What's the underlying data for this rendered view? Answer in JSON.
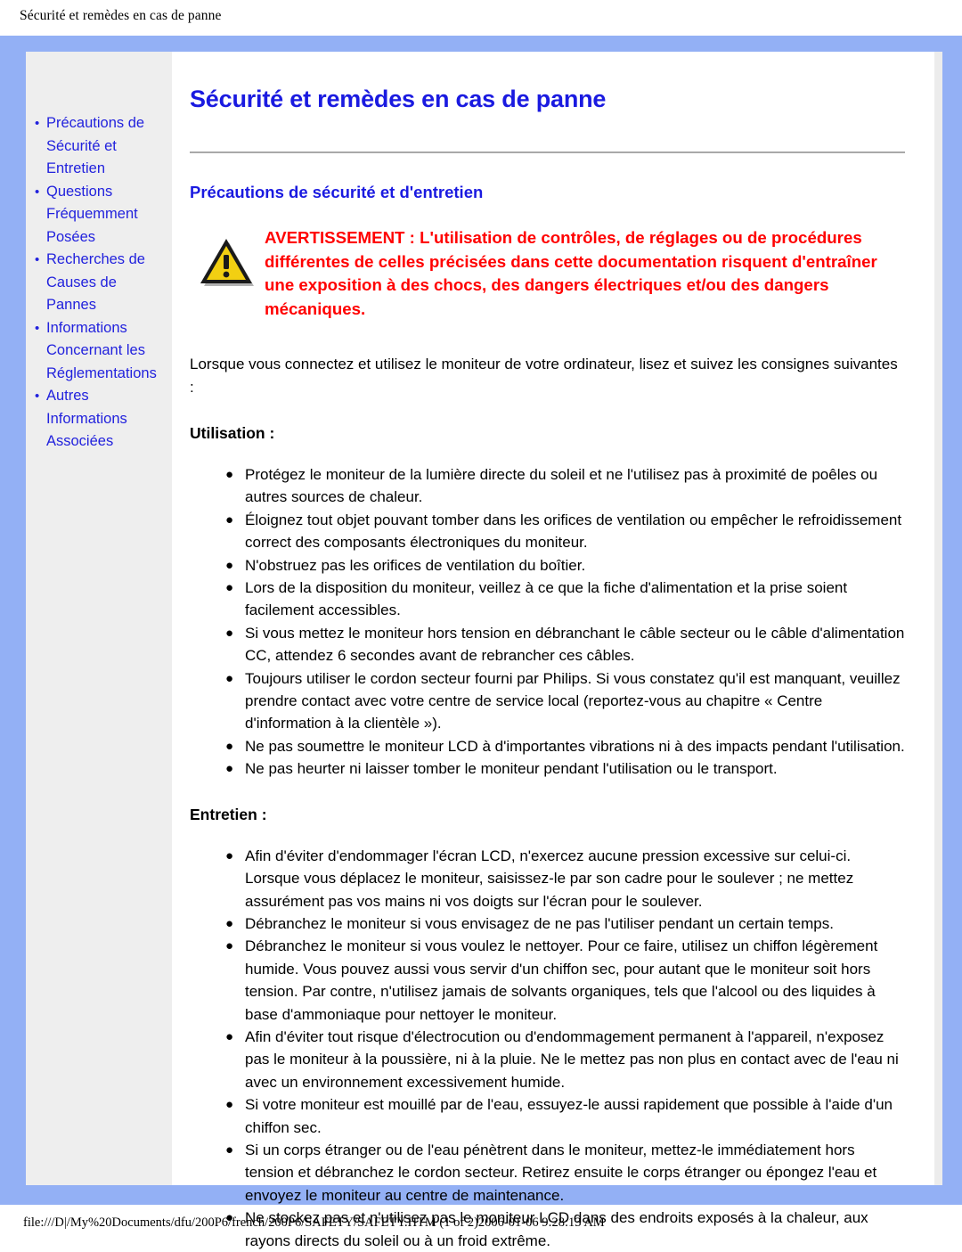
{
  "browser": {
    "header_title": "Sécurité et remèdes en cas de panne",
    "footer_text": "file:///D|/My%20Documents/dfu/200P6/french/200P6/SAFETY/SAFETY.HTM (1 of 2)2006-01-06 9:28:13 AM"
  },
  "colors": {
    "frame_blue": "#93b0f5",
    "sidebar_gray": "#eeeeee",
    "link_blue": "#2222dd",
    "heading_blue": "#1a1ae0",
    "warning_red": "#ff0000",
    "rule_gray": "#a9a9a9"
  },
  "sidebar": {
    "bullet": "•",
    "items": [
      {
        "label": "Précautions de Sécurité et Entretien"
      },
      {
        "label": "Questions Fréquemment Posées"
      },
      {
        "label": "Recherches de Causes de Pannes"
      },
      {
        "label": "Informations Concernant les Réglementations"
      },
      {
        "label": "Autres Informations Associées"
      }
    ]
  },
  "main": {
    "title": "Sécurité et remèdes en cas de panne",
    "section_title": "Précautions de sécurité et d'entretien",
    "warning": {
      "icon": "warning-triangle-icon",
      "text": "AVERTISSEMENT : L'utilisation de contrôles, de réglages ou de procédures différentes de celles précisées dans cette documentation risquent d'entraîner une exposition à des chocs, des dangers électriques et/ou des dangers mécaniques."
    },
    "intro": "Lorsque vous connectez et utilisez le moniteur de votre ordinateur, lisez et suivez les consignes suivantes :",
    "list_bullet": "●",
    "usage": {
      "heading": "Utilisation :",
      "items": [
        "Protégez le moniteur de la lumière directe du soleil et ne l'utilisez pas à proximité de poêles ou autres sources de chaleur.",
        "Éloignez tout objet pouvant tomber dans les orifices de ventilation ou empêcher le refroidissement correct des composants électroniques du moniteur.",
        "N'obstruez pas les orifices de ventilation du boîtier.",
        "Lors de la disposition du moniteur, veillez à ce que la fiche d'alimentation et la prise soient facilement accessibles.",
        "Si vous mettez le moniteur hors tension en débranchant le câble secteur ou le câble d'alimentation CC, attendez 6 secondes avant de rebrancher ces câbles.",
        "Toujours utiliser le cordon secteur fourni par Philips. Si vous constatez qu'il est manquant, veuillez prendre contact avec votre centre de service local (reportez-vous au chapitre « Centre d'information à la clientèle »).",
        "Ne pas soumettre le moniteur LCD à d'importantes vibrations ni à des impacts pendant l'utilisation.",
        "Ne pas heurter ni laisser tomber le moniteur pendant l'utilisation ou le transport."
      ]
    },
    "maintenance": {
      "heading": "Entretien :",
      "items": [
        "Afin d'éviter d'endommager l'écran LCD, n'exercez aucune pression excessive sur celui-ci. Lorsque vous déplacez le moniteur, saisissez-le par son cadre pour le soulever ; ne mettez assurément pas vos mains ni vos doigts sur l'écran pour le soulever.",
        "Débranchez le moniteur si vous envisagez de ne pas l'utiliser pendant un certain temps.",
        "Débranchez le moniteur si vous voulez le nettoyer. Pour ce faire, utilisez un chiffon légèrement humide. Vous pouvez aussi vous servir d'un chiffon sec, pour autant que le moniteur soit hors tension. Par contre, n'utilisez jamais de solvants organiques, tels que l'alcool ou des liquides à base d'ammoniaque pour nettoyer le moniteur.",
        "Afin d'éviter tout risque d'électrocution ou d'endommagement permanent à l'appareil, n'exposez pas le moniteur à la poussière, ni à la pluie. Ne le mettez pas non plus en contact avec de l'eau ni avec un environnement excessivement humide.",
        "Si votre moniteur est mouillé par de l'eau, essuyez-le aussi rapidement que possible à l'aide d'un chiffon sec.",
        "Si un corps étranger ou de l'eau pénètrent dans le moniteur, mettez-le immédiatement hors tension et débranchez le cordon secteur. Retirez ensuite le corps étranger ou épongez l'eau et envoyez le moniteur au centre de maintenance.",
        "Ne stockez pas et n'utilisez pas le moniteur LCD dans des endroits exposés à la chaleur, aux rayons directs du soleil ou à un froid extrême."
      ]
    }
  }
}
